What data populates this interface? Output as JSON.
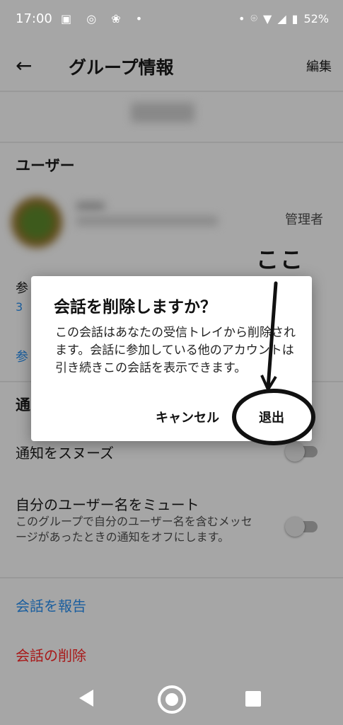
{
  "status_bar": {
    "time": "17:00",
    "battery": "52%"
  },
  "app_bar": {
    "title": "グループ情報",
    "edit_label": "編集"
  },
  "users_section": {
    "title": "ユーザー",
    "member_role": "管理者",
    "participants_partial": "参",
    "participants_count": "3",
    "link_partial": "参"
  },
  "notifications_section": {
    "title_partial": "通",
    "snooze_label": "通知をスヌーズ",
    "mute_label": "自分のユーザー名をミュート",
    "mute_description": "このグループで自分のユーザー名を含むメッセージがあったときの通知をオフにします。"
  },
  "actions": {
    "report": "会話を報告",
    "delete": "会話の削除"
  },
  "dialog": {
    "title": "会話を削除しますか？",
    "body": "この会話はあなたの受信トレイから削除されます。会話に参加している他のアカウントは引き続きこの会話を表示できます。",
    "cancel_label": "キャンセル",
    "leave_label": "退出"
  },
  "annotation": {
    "text": "ここ"
  }
}
